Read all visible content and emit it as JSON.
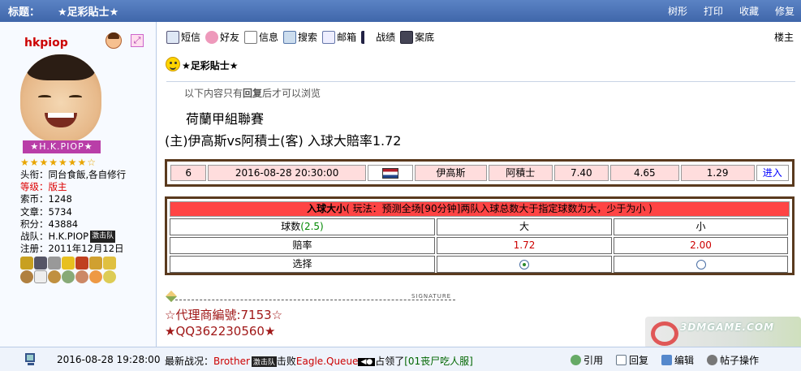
{
  "titlebar": {
    "label": "标题：",
    "title": "★足彩貼士★",
    "links": [
      "树形",
      "打印",
      "收藏",
      "修复"
    ]
  },
  "user": {
    "name": "hkpiop",
    "nameplate": "★H.K.PIOP★",
    "stars": "★★★★★★★☆",
    "rows": [
      {
        "k": "头衔：",
        "v": "同台食飯,各自修行"
      },
      {
        "k": "等级：",
        "v": "版主"
      },
      {
        "k": "索币：",
        "v": "1248"
      },
      {
        "k": "文章：",
        "v": "5734"
      },
      {
        "k": "积分：",
        "v": "43884"
      },
      {
        "k": "战队：",
        "v": "H.K.PIOP"
      },
      {
        "k": "注册：",
        "v": "2011年12月12日"
      }
    ],
    "team_badge": "激击队"
  },
  "toolbar": [
    "短信",
    "好友",
    "信息",
    "搜索",
    "邮箱",
    "战绩",
    "案底"
  ],
  "floor": "楼主",
  "post": {
    "title": "★足彩貼士★",
    "hint": "以下内容只有",
    "hint_bold": "回复",
    "hint_end": "后才可以浏览",
    "league": "荷蘭甲組聯賽",
    "match": "(主)伊高斯vs阿積士(客) 入球大賠率1.72"
  },
  "match_row": {
    "no": "6",
    "datetime": "2016-08-28 20:30:00",
    "home": "伊高斯",
    "away": "阿積士",
    "odd1": "7.40",
    "odd2": "4.65",
    "odd3": "1.29",
    "link": "进入"
  },
  "odds": {
    "head_bold": "入球大小",
    "head_rest": "( 玩法：预测全场[90分钟]两队入球总数大于指定球数为大，少于为小 )",
    "rows": {
      "line_label": "球数",
      "line_value": "(2.5)",
      "big": "大",
      "small": "小",
      "odds_label": "赔率",
      "big_odds": "1.72",
      "small_odds": "2.00",
      "choose_label": "选择"
    }
  },
  "signature": {
    "word": "SIGNATURE",
    "line1": "☆代理商編號:7153☆",
    "line2": "★QQ362230560★"
  },
  "bottom": {
    "time": "2016-08-28 19:28:00",
    "latest_label": "最新战况：",
    "team1": "Brother",
    "team1_badge": "激击队",
    "beat": "击败",
    "team2": "Eagle.Queue",
    "team2_badge": "◀●",
    "occupied": "占领了",
    "place": "[01丧尸吃人服]",
    "actions": [
      "引用",
      "回复",
      "编辑",
      "帖子操作"
    ]
  },
  "watermark": "3DMGAME.COM"
}
